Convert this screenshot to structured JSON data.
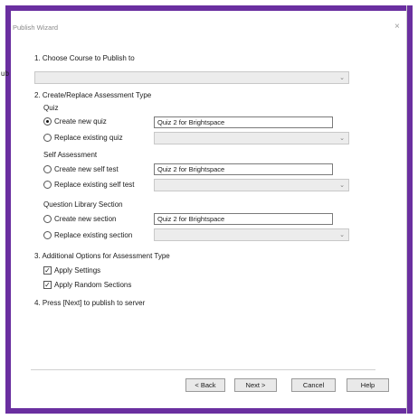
{
  "window": {
    "title": "Publish Wizard",
    "close_glyph": "×"
  },
  "truncated_left_label": "ub",
  "step1": {
    "label": "1. Choose Course to Publish to",
    "course_value": ""
  },
  "step2": {
    "label": "2. Create/Replace Assessment Type",
    "quiz": {
      "group_label": "Quiz",
      "create_label": "Create new quiz",
      "create_value": "Quiz 2 for Brightspace",
      "replace_label": "Replace existing quiz",
      "selected": "create"
    },
    "self": {
      "group_label": "Self Assessment",
      "create_label": "Create new self test",
      "create_value": "Quiz 2 for Brightspace",
      "replace_label": "Replace existing self test",
      "selected": "none"
    },
    "library": {
      "group_label": "Question Library Section",
      "create_label": "Create new section",
      "create_value": "Quiz 2 for Brightspace",
      "replace_label": "Replace existing section",
      "selected": "none"
    }
  },
  "step3": {
    "label": "3. Additional Options for Assessment Type",
    "apply_settings_label": "Apply Settings",
    "apply_settings_checked": true,
    "apply_random_label": "Apply Random Sections",
    "apply_random_checked": true
  },
  "step4": {
    "label": "4. Press [Next] to publish to server"
  },
  "buttons": {
    "back": "< Back",
    "next": "Next >",
    "cancel": "Cancel",
    "help": "Help"
  },
  "colors": {
    "frame": "#6a2fa0",
    "combo_bg": "#ececec"
  },
  "icons": {
    "dropdown": "chevron-down-icon",
    "check": "checkmark-icon"
  }
}
